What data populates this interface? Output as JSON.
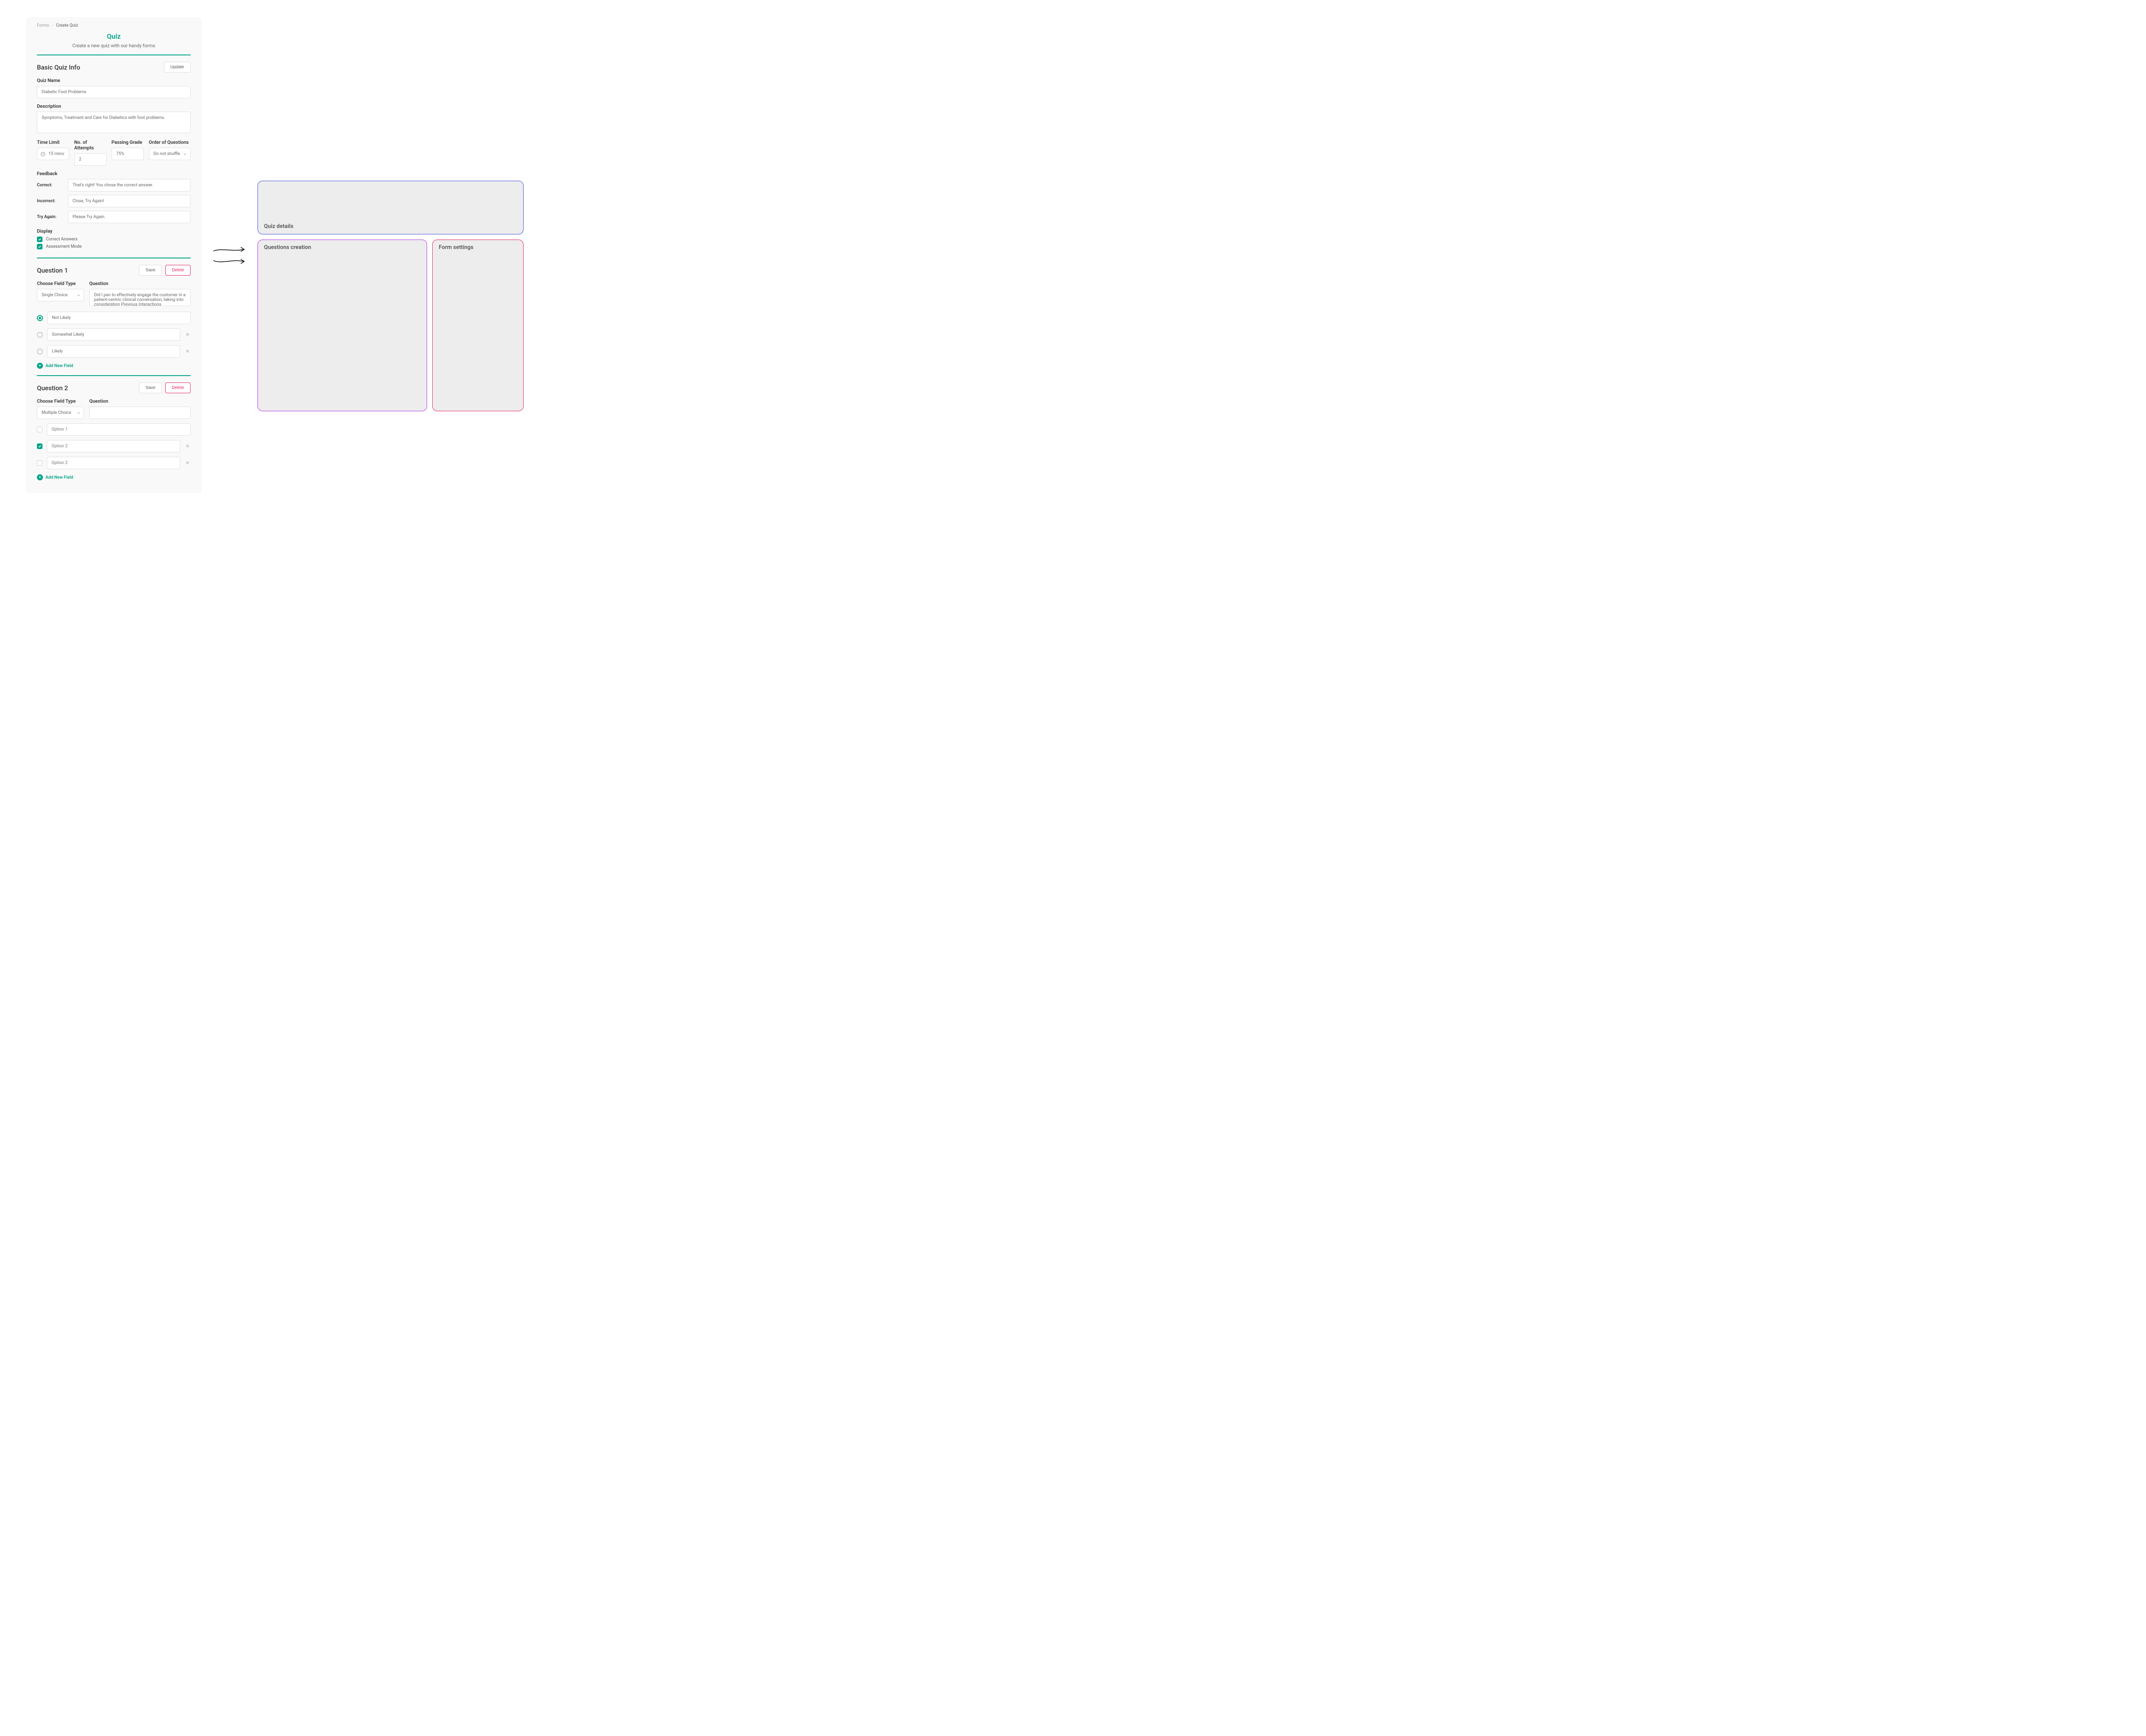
{
  "breadcrumb": {
    "parent": "Forms",
    "current": "Create Quiz"
  },
  "page": {
    "title": "Quiz",
    "subtitle": "Create a new quiz with our handy forms"
  },
  "basic": {
    "heading": "Basic Quiz Info",
    "updateBtn": "Update",
    "quizNameLabel": "Quiz Name",
    "quizNameValue": "Diabetic Foot Problems",
    "descriptionLabel": "Description",
    "descriptionValue": "Symptoms, Treatment and Care for Diabetics with foot problems.",
    "timeLimitLabel": "Time Limit",
    "timeLimitValue": "15 minutes",
    "attemptsLabel": "No. of Attempts",
    "attemptsValue": "2",
    "passingLabel": "Passing Grade",
    "passingValue": "75%",
    "orderLabel": "Order of Questions",
    "orderValue": "Do not shuffle questions",
    "feedbackLabel": "Feedback",
    "correctLabel": "Correct:",
    "correctValue": "That's right! You chose the correct answer.",
    "incorrectLabel": "Incorrect:",
    "incorrectValue": "Close, Try Again!",
    "tryAgainLabel": "Try Again:",
    "tryAgainValue": "Please Try Again.",
    "displayLabel": "Display",
    "displayCorrect": "Correct Answers",
    "displayAssessment": "Assessment Mode"
  },
  "q1": {
    "heading": "Question 1",
    "saveBtn": "Save",
    "deleteBtn": "Delete",
    "fieldTypeLabel": "Choose Field Type",
    "fieldTypeValue": "Single Choice",
    "questionLabel": "Question",
    "questionValue": "Did I pan to effectively engage the customer in a patient-centric clinical conversation, taking into consideration Previous Interactions",
    "opt1": "Not Likely",
    "opt2": "Somewhat Likely",
    "opt3": "Likely",
    "addField": "Add New Field"
  },
  "q2": {
    "heading": "Question 2",
    "saveBtn": "Save",
    "deleteBtn": "Delete",
    "fieldTypeLabel": "Choose Field Type",
    "fieldTypeValue": "Multiple Choice",
    "questionLabel": "Question",
    "questionValue": "",
    "opt1Placeholder": "Option 1",
    "opt2Placeholder": "Option 2",
    "opt3Placeholder": "Option 2",
    "addField": "Add New Field"
  },
  "wireframe": {
    "details": "Quiz details",
    "questions": "Questions creation",
    "settings": "Form settings"
  }
}
